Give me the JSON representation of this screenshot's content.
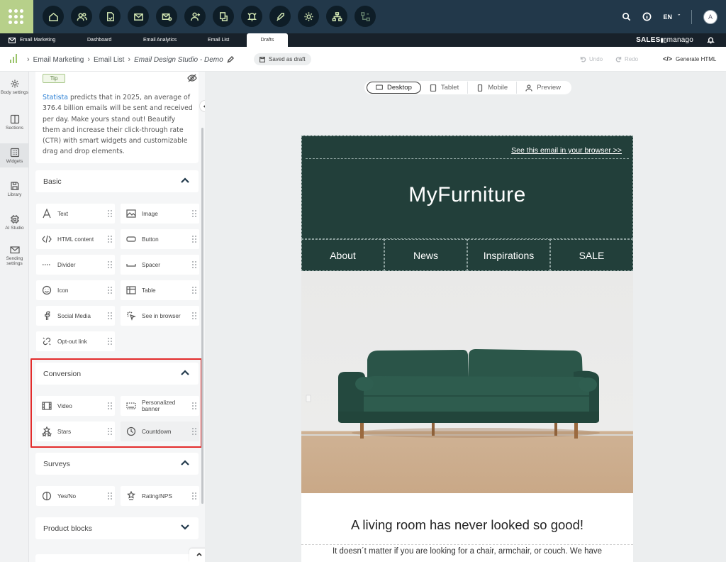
{
  "topbar": {
    "nav_icons": [
      "home-icon",
      "contacts-icon",
      "document-hand-icon",
      "mail-icon",
      "mail-settings-icon",
      "add-user-icon",
      "workflow-icon",
      "bell-settings-icon",
      "rocket-icon",
      "gear-icon",
      "hierarchy-icon",
      "flow-icon"
    ],
    "lang": "EN",
    "avatar": "A"
  },
  "tabs": {
    "email_marketing": "Email Marketing",
    "dashboard": "Dashboard",
    "email_analytics": "Email Analytics",
    "email_list": "Email List",
    "drafts": "Drafts",
    "brand_bold": "SALES",
    "brand_light": "manago"
  },
  "breadcrumb": {
    "item1": "Email Marketing",
    "item2": "Email List",
    "current": "Email Design Studio - Demo",
    "saved": "Saved as draft",
    "undo": "Undo",
    "redo": "Redo",
    "generate": "Generate HTML"
  },
  "rail": {
    "body": "Body settings",
    "sections": "Sections",
    "widgets": "Widgets",
    "library": "Library",
    "ai": "AI Studio",
    "sending": "Sending settings"
  },
  "tip": {
    "badge": "Tip",
    "link": "Statista",
    "text": " predicts that in 2025, an average of 376.4 billion emails will be sent and received per day. Make yours stand out! Beautify them and increase their click-through rate (CTR) with smart widgets and customizable drag and drop elements."
  },
  "sections": {
    "basic": "Basic",
    "conversion": "Conversion",
    "surveys": "Surveys",
    "product_blocks": "Product blocks"
  },
  "widgets": {
    "text": "Text",
    "image": "Image",
    "html": "HTML content",
    "button": "Button",
    "divider": "Divider",
    "spacer": "Spacer",
    "icon": "Icon",
    "table": "Table",
    "social": "Social Media",
    "see_browser": "See in browser",
    "optout": "Opt-out link",
    "video": "Video",
    "personalized_1": "Personalized",
    "personalized_2": "banner",
    "stars": "Stars",
    "countdown": "Countdown",
    "yesno": "Yes/No",
    "rating": "Rating/NPS"
  },
  "devices": {
    "desktop": "Desktop",
    "tablet": "Tablet",
    "mobile": "Mobile",
    "preview": "Preview"
  },
  "email": {
    "browser_link": "See this email in your browser >>",
    "title": "MyFurniture",
    "nav": [
      "About",
      "News",
      "Inspirations",
      "SALE"
    ],
    "headline": "A living room has never looked so good!",
    "body": "It doesn´t matter if you are looking for a chair, armchair, or couch. We have"
  },
  "colors": {
    "topbar": "#22384a",
    "accent": "#b7d08a",
    "email_header": "#223f3a",
    "highlight": "#e32b2b"
  }
}
